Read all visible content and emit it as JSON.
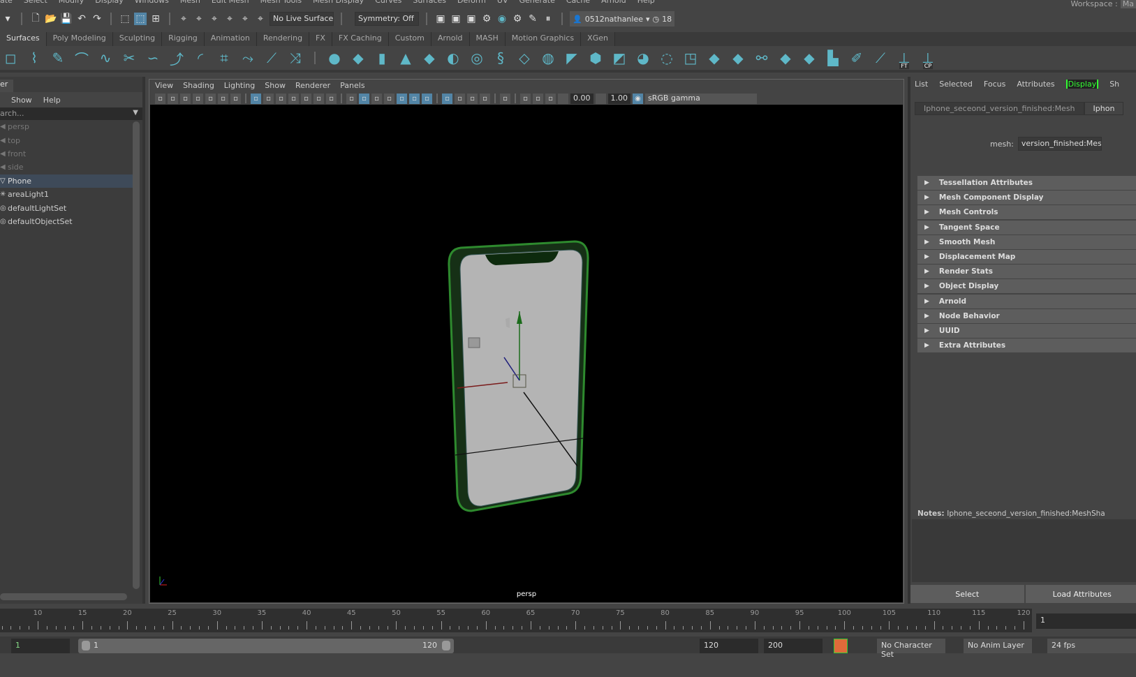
{
  "menubar": [
    "ate",
    "Select",
    "Modify",
    "Display",
    "Windows",
    "Mesh",
    "Edit Mesh",
    "Mesh Tools",
    "Mesh Display",
    "Curves",
    "Surfaces",
    "Deform",
    "UV",
    "Generate",
    "Cache",
    "Arnold",
    "Help"
  ],
  "workspace": {
    "label": "Workspace :",
    "value": "Ma"
  },
  "status": {
    "live_surface": "No Live Surface",
    "symmetry": "Symmetry: Off",
    "user": "0512nathanlee",
    "notifications": "18"
  },
  "shelf_tabs": [
    "Surfaces",
    "Poly Modeling",
    "Sculpting",
    "Rigging",
    "Animation",
    "Rendering",
    "FX",
    "FX Caching",
    "Custom",
    "Arnold",
    "MASH",
    "Motion Graphics",
    "XGen"
  ],
  "shelf_icons": [
    {
      "name": "square-curve-icon",
      "g": "◻"
    },
    {
      "name": "cv-curve-icon",
      "g": "⌇"
    },
    {
      "name": "ep-curve-icon",
      "g": "✎"
    },
    {
      "name": "bezier-icon",
      "g": "⌒"
    },
    {
      "name": "arc-icon",
      "g": "∿"
    },
    {
      "name": "cut-curve-icon",
      "g": "✂"
    },
    {
      "name": "curve-icon",
      "g": "∽"
    },
    {
      "name": "curve2-icon",
      "g": "⤴"
    },
    {
      "name": "circle-arc-icon",
      "g": "◜"
    },
    {
      "name": "attach-icon",
      "g": "⌗"
    },
    {
      "name": "detach-icon",
      "g": "⤳"
    },
    {
      "name": "extend-icon",
      "g": "⟋"
    },
    {
      "name": "insert-knot-icon",
      "g": "⤨"
    },
    {
      "name": "sphere-icon",
      "g": "●"
    },
    {
      "name": "cube-icon",
      "g": "◆"
    },
    {
      "name": "cylinder-icon",
      "g": "▮"
    },
    {
      "name": "cone-icon",
      "g": "▲"
    },
    {
      "name": "plane-icon",
      "g": "◆"
    },
    {
      "name": "torus-icon",
      "g": "◐"
    },
    {
      "name": "revolve-icon",
      "g": "◎"
    },
    {
      "name": "loft-icon",
      "g": "§"
    },
    {
      "name": "planar-icon",
      "g": "◇"
    },
    {
      "name": "extrude-icon",
      "g": "◍"
    },
    {
      "name": "birail-icon",
      "g": "◤"
    },
    {
      "name": "boundary-icon",
      "g": "⬢"
    },
    {
      "name": "square-surface-icon",
      "g": "◩"
    },
    {
      "name": "bevel-icon",
      "g": "◕"
    },
    {
      "name": "intersect-icon",
      "g": "◌"
    },
    {
      "name": "project-icon",
      "g": "◳"
    },
    {
      "name": "trim-icon",
      "g": "◆"
    },
    {
      "name": "untrim-icon",
      "g": "◆"
    },
    {
      "name": "booleans-icon",
      "g": "⚯"
    },
    {
      "name": "attach-surface-icon",
      "g": "◆"
    },
    {
      "name": "detach-surface-icon",
      "g": "◆"
    },
    {
      "name": "align-icon",
      "g": "▙"
    },
    {
      "name": "sculpt-icon",
      "g": "✐"
    },
    {
      "name": "rebuild-icon",
      "g": "⟋"
    },
    {
      "name": "ft-icon",
      "g": "⊥",
      "label": "FT"
    },
    {
      "name": "cp-icon",
      "g": "⊥",
      "label": "CP"
    }
  ],
  "outliner": {
    "title": "er",
    "menu": [
      "Show",
      "Help"
    ],
    "search_placeholder": "arch...",
    "items": [
      {
        "label": "persp",
        "state": "dim",
        "icon": "camera-icon"
      },
      {
        "label": "top",
        "state": "dim",
        "icon": "camera-icon"
      },
      {
        "label": "front",
        "state": "dim",
        "icon": "camera-icon"
      },
      {
        "label": "side",
        "state": "dim",
        "icon": "camera-icon"
      },
      {
        "label": "Phone",
        "state": "selected",
        "icon": "mesh-icon"
      },
      {
        "label": "areaLight1",
        "state": "normal",
        "icon": "light-icon"
      },
      {
        "label": "defaultLightSet",
        "state": "normal",
        "icon": "set-icon"
      },
      {
        "label": "defaultObjectSet",
        "state": "normal",
        "icon": "set-icon"
      }
    ]
  },
  "viewport": {
    "menu": [
      "View",
      "Shading",
      "Lighting",
      "Show",
      "Renderer",
      "Panels"
    ],
    "exposure": "0.00",
    "gamma": "1.00",
    "color_space": "sRGB gamma",
    "camera": "persp"
  },
  "attribute_editor": {
    "tabs": [
      "List",
      "Selected",
      "Focus",
      "Attributes",
      "Display",
      "Sh"
    ],
    "highlighted_tab": "Display",
    "node_tabs": [
      "Iphone_seceond_version_finished:Mesh",
      "Iphon"
    ],
    "mesh_label": "mesh:",
    "mesh_value": "version_finished:MeshS",
    "sections": [
      "Tessellation Attributes",
      "Mesh Component Display",
      "Mesh Controls",
      "Tangent Space",
      "Smooth Mesh",
      "Displacement Map",
      "Render Stats",
      "Object Display",
      "Arnold",
      "Node Behavior",
      "UUID",
      "Extra Attributes"
    ],
    "notes_label": "Notes:",
    "notes_value": "Iphone_seceond_version_finished:MeshSha",
    "select_button": "Select",
    "load_button": "Load Attributes"
  },
  "timeline": {
    "ticks": [
      10,
      15,
      20,
      25,
      30,
      35,
      40,
      45,
      50,
      55,
      60,
      65,
      70,
      75,
      80,
      85,
      90,
      95,
      100,
      105,
      110,
      115,
      120
    ],
    "current_frame": "1"
  },
  "range": {
    "start": "1",
    "slider_start": "1",
    "slider_end": "120",
    "end": "120",
    "max": "200",
    "character_set": "No Character Set",
    "anim_layer": "No Anim Layer",
    "fps": "24 fps"
  }
}
